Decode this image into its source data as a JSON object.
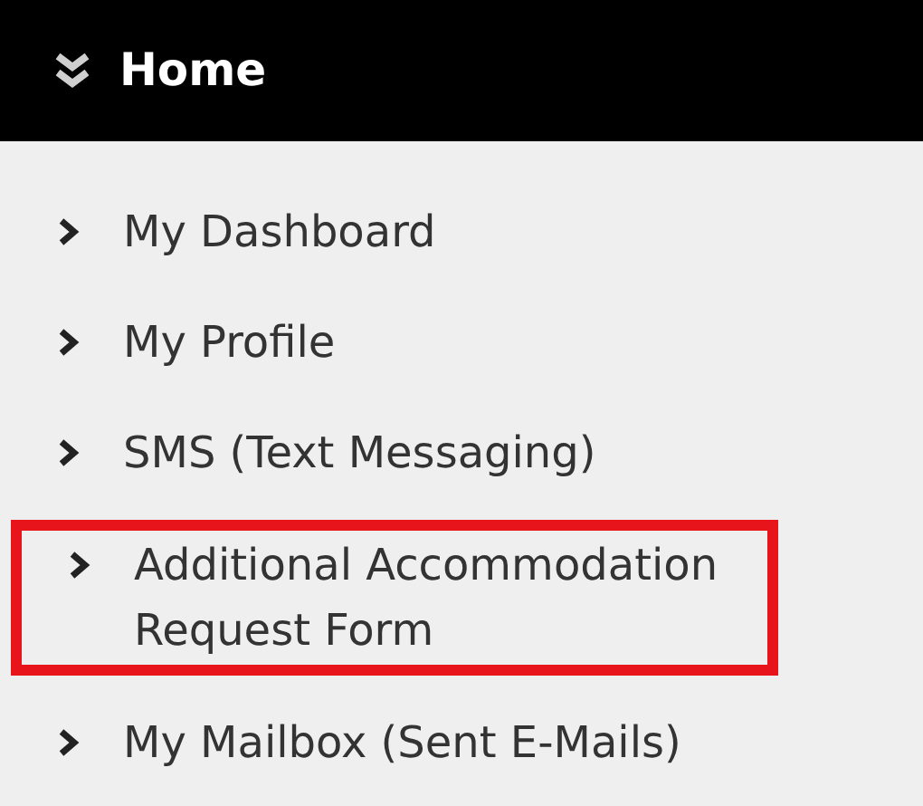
{
  "header": {
    "title": "Home"
  },
  "menu": [
    {
      "label": "My Dashboard",
      "highlighted": false
    },
    {
      "label": "My Profile",
      "highlighted": false
    },
    {
      "label": "SMS (Text Messaging)",
      "highlighted": false
    },
    {
      "label": "Additional Accommodation Request Form",
      "highlighted": true
    },
    {
      "label": "My Mailbox (Sent E-Mails)",
      "highlighted": false
    }
  ]
}
